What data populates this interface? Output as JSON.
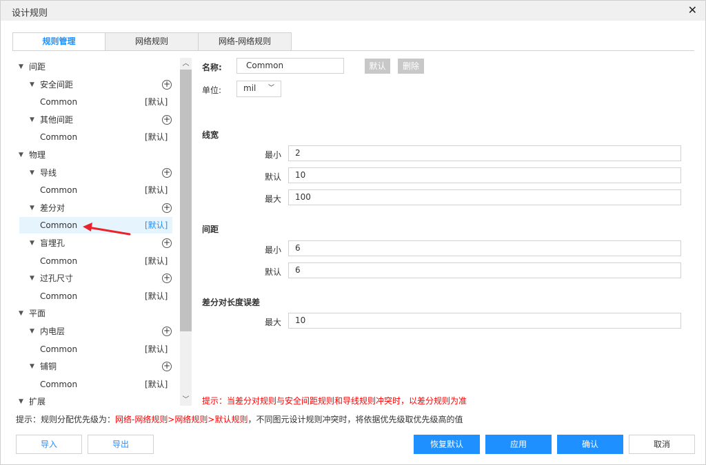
{
  "window": {
    "title": "设计规则",
    "close": "✕"
  },
  "tabs": [
    {
      "label": "规则管理",
      "active": true
    },
    {
      "label": "网络规则"
    },
    {
      "label": "网络-网络规则"
    }
  ],
  "tree": [
    {
      "level": 0,
      "label": "间距",
      "expand": true
    },
    {
      "level": 1,
      "label": "安全间距",
      "expand": true,
      "add": true
    },
    {
      "level": 2,
      "label": "Common",
      "tag": "[默认]"
    },
    {
      "level": 1,
      "label": "其他间距",
      "expand": true,
      "add": true
    },
    {
      "level": 2,
      "label": "Common",
      "tag": "[默认]"
    },
    {
      "level": 0,
      "label": "物理",
      "expand": true
    },
    {
      "level": 1,
      "label": "导线",
      "expand": true,
      "add": true
    },
    {
      "level": 2,
      "label": "Common",
      "tag": "[默认]"
    },
    {
      "level": 1,
      "label": "差分对",
      "expand": true,
      "add": true
    },
    {
      "level": 2,
      "label": "Common",
      "tag": "[默认]",
      "selected": true
    },
    {
      "level": 1,
      "label": "盲埋孔",
      "expand": true,
      "add": true
    },
    {
      "level": 2,
      "label": "Common",
      "tag": "[默认]"
    },
    {
      "level": 1,
      "label": "过孔尺寸",
      "expand": true,
      "add": true
    },
    {
      "level": 2,
      "label": "Common",
      "tag": "[默认]"
    },
    {
      "level": 0,
      "label": "平面",
      "expand": true
    },
    {
      "level": 1,
      "label": "内电层",
      "expand": true,
      "add": true
    },
    {
      "level": 2,
      "label": "Common",
      "tag": "[默认]"
    },
    {
      "level": 1,
      "label": "铺铜",
      "expand": true,
      "add": true
    },
    {
      "level": 2,
      "label": "Common",
      "tag": "[默认]"
    },
    {
      "level": 0,
      "label": "扩展",
      "expand": true
    }
  ],
  "form": {
    "name_label": "名称:",
    "name_value": "Common",
    "default_btn": "默认",
    "delete_btn": "删除",
    "unit_label": "单位:",
    "unit_value": "mil",
    "sections": [
      {
        "title": "线宽",
        "fields": [
          {
            "label": "最小",
            "value": "2"
          },
          {
            "label": "默认",
            "value": "10"
          },
          {
            "label": "最大",
            "value": "100"
          }
        ]
      },
      {
        "title": "间距",
        "fields": [
          {
            "label": "最小",
            "value": "6"
          },
          {
            "label": "默认",
            "value": "6"
          }
        ]
      },
      {
        "title": "差分对长度误差",
        "fields": [
          {
            "label": "最大",
            "value": "10"
          }
        ]
      }
    ],
    "hint": "提示：当差分对规则与安全间距规则和导线规则冲突时，以差分规则为准"
  },
  "footer_hint": {
    "prefix": "提示：规则分配优先级为：",
    "highlight": "网络-网络规则>网络规则>默认规则",
    "suffix": "，不同图元设计规则冲突时，将依据优先级取优先级高的值"
  },
  "buttons": {
    "import": "导入",
    "export": "导出",
    "restore": "恢复默认",
    "apply": "应用",
    "ok": "确认",
    "cancel": "取消"
  },
  "colors": {
    "accent": "#1e90ff",
    "warning": "#ff0000"
  }
}
